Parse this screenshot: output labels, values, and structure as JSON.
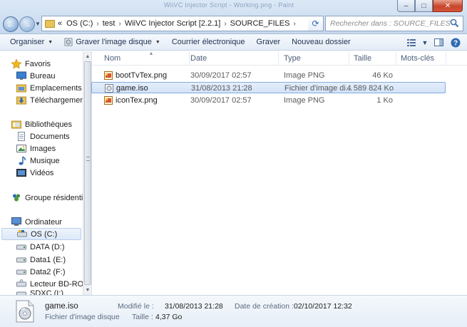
{
  "window": {
    "caption_ghost": "WiiVC Injector Script - Working.png - Paint",
    "minimize_glyph": "–",
    "maximize_glyph": "□",
    "close_glyph": "✕"
  },
  "address": {
    "overflow": "«",
    "separator": "›",
    "crumbs": [
      "OS (C:)",
      "test",
      "WiiVC Injector Script [2.2.1]",
      "SOURCE_FILES"
    ]
  },
  "search": {
    "placeholder": "Rechercher dans : SOURCE_FILES"
  },
  "toolbar": {
    "organize": "Organiser",
    "burn_image": "Graver l'image disque",
    "email": "Courrier électronique",
    "burn": "Graver",
    "new_folder": "Nouveau dossier"
  },
  "nav": {
    "favorites": "Favoris",
    "desktop": "Bureau",
    "recent": "Emplacements récents",
    "downloads": "Téléchargements",
    "libraries": "Bibliothèques",
    "documents": "Documents",
    "images": "Images",
    "music": "Musique",
    "videos": "Vidéos",
    "homegroup": "Groupe résidentiel",
    "computer": "Ordinateur",
    "os": "OS (C:)",
    "data": "DATA (D:)",
    "data1": "Data1 (E:)",
    "data2": "Data2 (F:)",
    "bd": "Lecteur BD-ROM",
    "sdxc": "SDXC (I:)"
  },
  "columns": {
    "name": "Nom",
    "date": "Date",
    "type": "Type",
    "size": "Taille",
    "tags": "Mots-clés"
  },
  "files": [
    {
      "name": "bootTvTex.png",
      "date": "30/09/2017 02:57",
      "type": "Image PNG",
      "size": "46 Ko",
      "icon": "png-file-icon"
    },
    {
      "name": "game.iso",
      "date": "31/08/2013 21:28",
      "type": "Fichier d'image di...",
      "size": "4 589 824 Ko",
      "icon": "iso-file-icon"
    },
    {
      "name": "iconTex.png",
      "date": "30/09/2017 02:57",
      "type": "Image PNG",
      "size": "1 Ko",
      "icon": "png-file-icon"
    }
  ],
  "details": {
    "name": "game.iso",
    "type": "Fichier d'image disque",
    "modified_label": "Modifié le :",
    "modified_value": "31/08/2013 21:28",
    "size_label": "Taille :",
    "size_value": "4,37 Go",
    "created_label": "Date de création :",
    "created_value": "02/10/2017 12:32"
  },
  "colors": {
    "selection_border": "#84acdd",
    "selection_fill": "#d9e7f9",
    "chrome": "#dbe8f6"
  }
}
